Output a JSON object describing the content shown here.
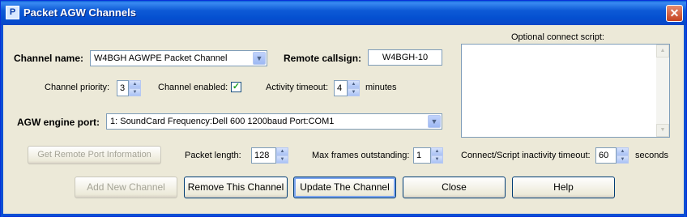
{
  "window": {
    "title": "Packet AGW Channels",
    "app_icon_glyph": "P",
    "close_glyph": "✕"
  },
  "channel_name": {
    "label": "Channel name:",
    "value": "W4BGH AGWPE Packet Channel"
  },
  "remote_callsign": {
    "label": "Remote callsign:",
    "value": "W4BGH-10"
  },
  "channel_priority": {
    "label": "Channel priority:",
    "value": "3"
  },
  "channel_enabled": {
    "label": "Channel enabled:",
    "checked": true,
    "check_glyph": "✓"
  },
  "activity_timeout": {
    "label": "Activity timeout:",
    "value": "4",
    "unit": "minutes"
  },
  "agw_engine_port": {
    "label": "AGW engine port:",
    "value": "1: SoundCard Frequency:Dell 600 1200baud Port:COM1"
  },
  "optional_script": {
    "label": "Optional connect script:",
    "value": ""
  },
  "get_remote_port_button": {
    "label": "Get Remote Port Information",
    "enabled": false
  },
  "packet_length": {
    "label": "Packet length:",
    "value": "128"
  },
  "max_frames": {
    "label": "Max frames outstanding:",
    "value": "1"
  },
  "inactivity_timeout": {
    "label": "Connect/Script inactivity timeout:",
    "value": "60",
    "unit": "seconds"
  },
  "buttons": {
    "add_new": {
      "label": "Add New Channel",
      "enabled": false
    },
    "remove": {
      "label": "Remove This Channel"
    },
    "update": {
      "label": "Update The Channel"
    },
    "close": {
      "label": "Close"
    },
    "help": {
      "label": "Help"
    }
  },
  "glyphs": {
    "dropdown": "▼",
    "spin_up": "▲",
    "spin_down": "▼",
    "scroll_up": "▲",
    "scroll_down": "▼"
  },
  "colors": {
    "titlebar": "#0a5fd8",
    "dialog_bg": "#ece9d8",
    "field_border": "#7f9db9",
    "check": "#21a121"
  }
}
